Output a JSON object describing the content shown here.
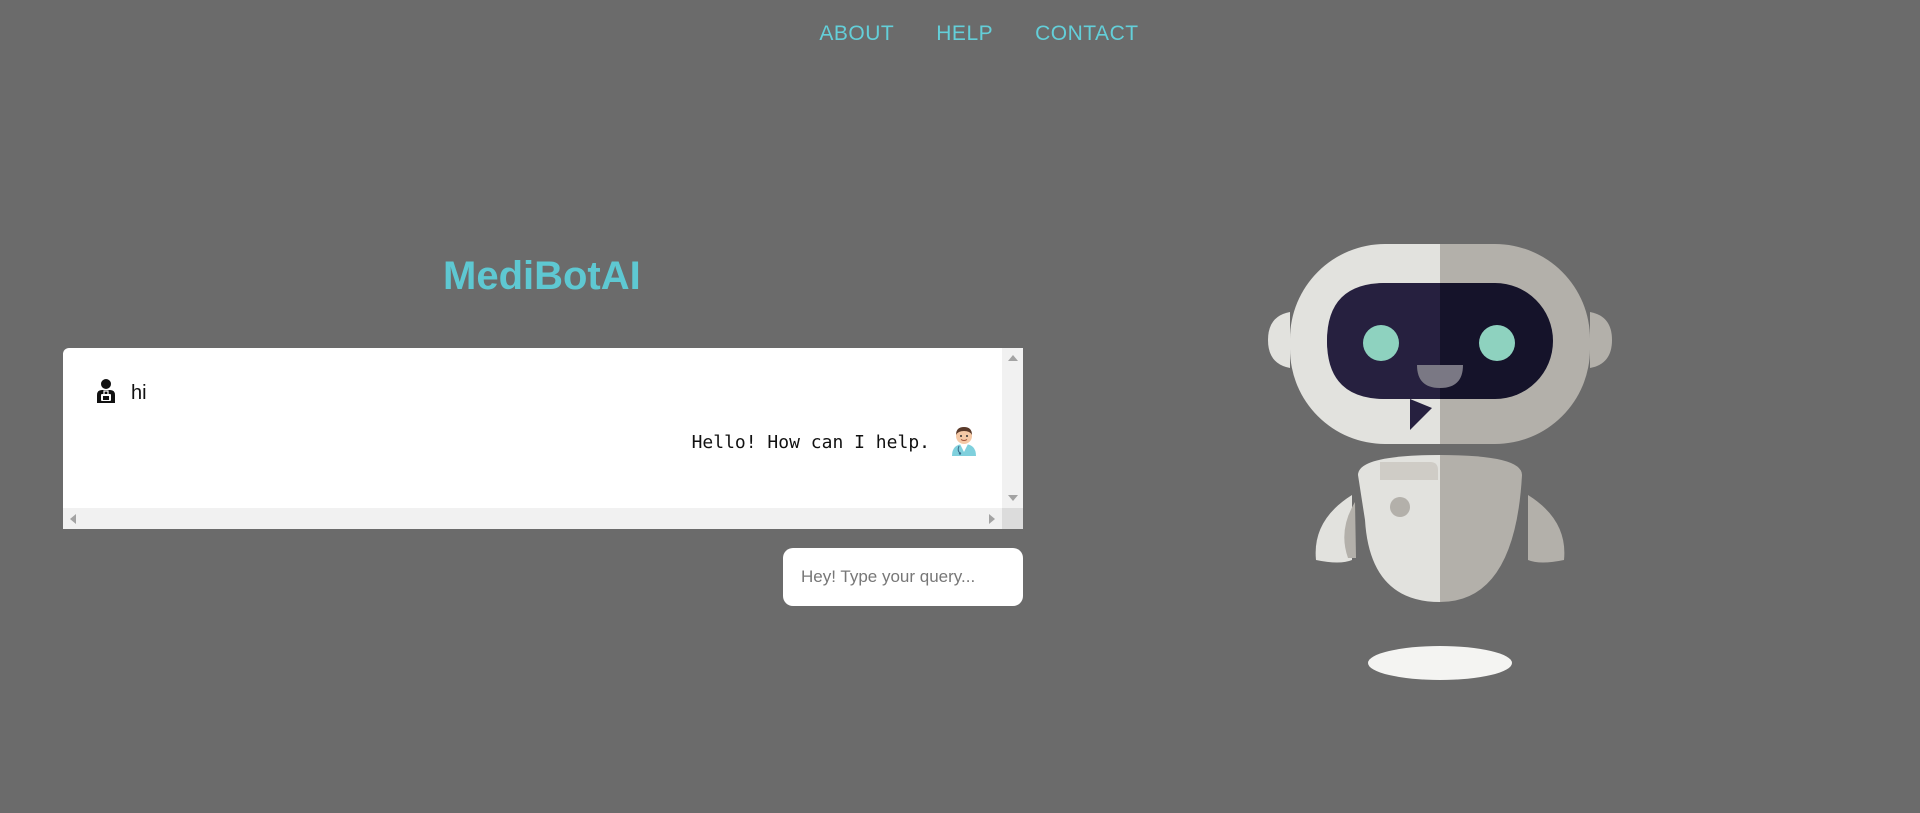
{
  "nav": {
    "items": [
      "ABOUT",
      "HELP",
      "CONTACT"
    ]
  },
  "title": "MediBotAI",
  "chat": {
    "messages": [
      {
        "sender": "user",
        "text": "hi",
        "icon": "user-icon"
      },
      {
        "sender": "bot",
        "text": "Hello! How can I help.",
        "icon": "doctor-avatar-icon"
      }
    ]
  },
  "input": {
    "placeholder": "Hey! Type your query...",
    "value": ""
  },
  "colors": {
    "background": "#6b6b6b",
    "accent": "#5ec8d2",
    "panel": "#ffffff"
  }
}
